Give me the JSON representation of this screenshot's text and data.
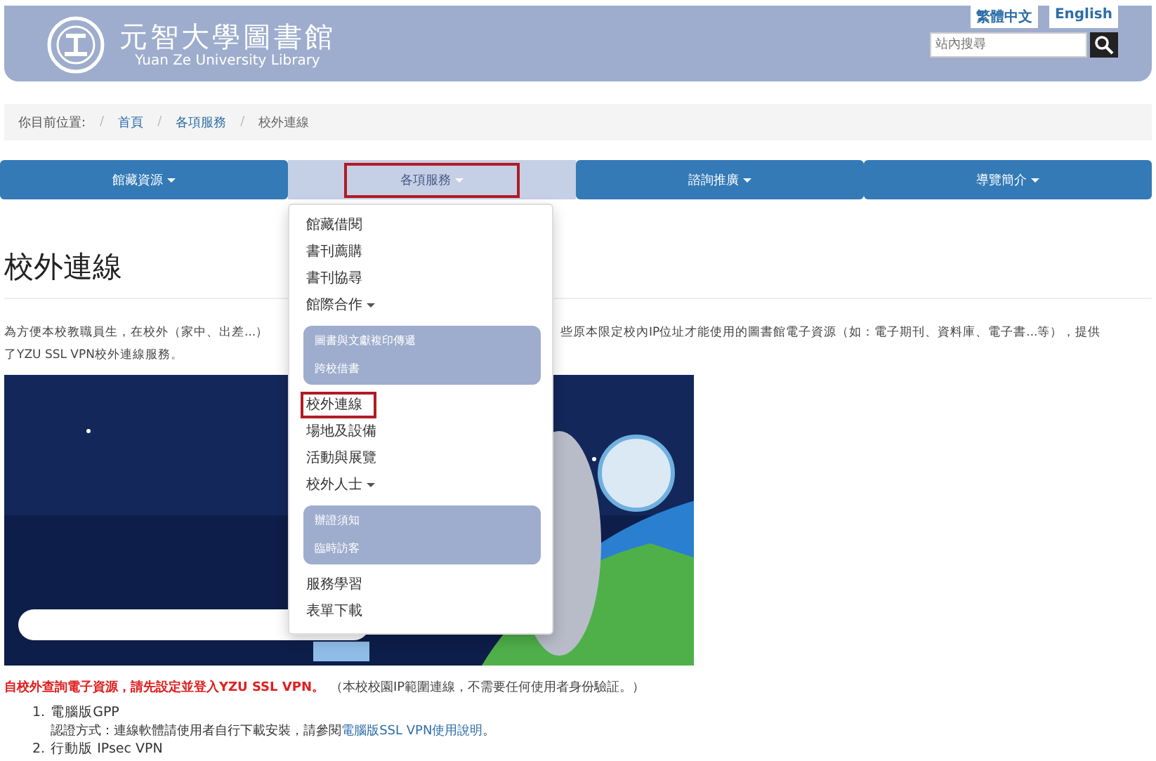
{
  "header": {
    "title": "元智大學圖書館",
    "subtitle": "Yuan Ze University Library",
    "languages": [
      "繁體中文",
      "English"
    ],
    "search": {
      "placeholder": "站內搜尋"
    }
  },
  "breadcrumb": {
    "label": "你目前位置:",
    "crumbs": [
      {
        "sep": "/",
        "label": "首頁",
        "link": true
      },
      {
        "sep": "/",
        "label": "各項服務",
        "link": true
      },
      {
        "sep": "/",
        "label": "校外連線",
        "link": false
      }
    ]
  },
  "nav": [
    {
      "label": "館藏資源",
      "selected": false
    },
    {
      "label": "各項服務",
      "selected": true
    },
    {
      "label": "諮詢推廣",
      "selected": false
    },
    {
      "label": "導覽簡介",
      "selected": false
    }
  ],
  "menu": {
    "items": [
      {
        "label": "館藏借閱",
        "selected": false
      },
      {
        "label": "書刊薦購",
        "selected": false
      },
      {
        "label": "書刊協尋",
        "selected": false
      },
      {
        "label": "館際合作",
        "selected": false,
        "expanded": true,
        "children": [
          {
            "label": "圖書與文獻複印傳遞"
          },
          {
            "label": "跨校借書"
          }
        ]
      },
      {
        "label": "校外連線",
        "selected": true
      },
      {
        "label": "場地及設備",
        "selected": false
      },
      {
        "label": "活動與展覽",
        "selected": false
      },
      {
        "label": "校外人士",
        "selected": false,
        "expanded": true,
        "children": [
          {
            "label": "辦證須知"
          },
          {
            "label": "臨時訪客"
          }
        ]
      },
      {
        "label": "服務學習",
        "selected": false
      },
      {
        "label": "表單下載",
        "selected": false
      }
    ]
  },
  "page": {
    "title": "校外連線",
    "intro_line_1_start": "為方便本校教職員生，在校外（家中、出差...）",
    "intro_line_1_end": "些原本限定校內IP位址才能使用的圖書館電子資源（如：電子期刊、資料庫、電子書...等），提供",
    "intro_line_2": "了YZU SSL VPN校外連線服務。",
    "notice": "自校外查詢電子資源，請先設定並登入YZU SSL VPN。",
    "notice_note": "（本校校園IP範圍連線，不需要任何使用者身份驗証。）",
    "steps": [
      {
        "number": "1.",
        "title": "電腦版GPP",
        "detail": "認證方式：連線軟體請使用者自行下載安裝，請參閱",
        "link": "電腦版SSL VPN使用說明",
        "after": "。"
      },
      {
        "number": "2.",
        "title": "行動版 IPsec VPN"
      }
    ]
  }
}
